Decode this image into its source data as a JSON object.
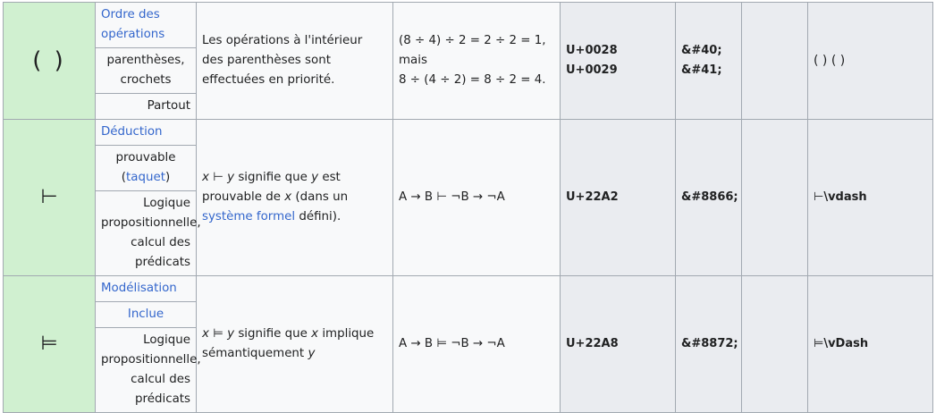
{
  "rows": [
    {
      "symbol": "( )",
      "category": "Ordre des opérations",
      "name": "parenthèses, crochets",
      "domain": "Partout",
      "description": "Les opérations à l'intérieur des parenthèses sont effectuées en priorité.",
      "example_line1": "(8 ÷ 4) ÷ 2 = 2 ÷ 2 = 1, mais",
      "example_line2": "8 ÷ (4 ÷ 2) = 8 ÷ 2 = 4.",
      "unicode": "U+0028 U+0029",
      "entity_1": "&#40;",
      "entity_2": "&#41;",
      "latex": "( ) ( )"
    },
    {
      "symbol": "⊢",
      "category": "Déduction",
      "name_part1": "prouvable",
      "name_link": "taquet",
      "domain": "Logique propositionnelle, calcul des prédicats",
      "desc_x": "x",
      "desc_rel": " ⊢ ",
      "desc_y": "y",
      "desc_text1": " signifie que ",
      "desc_y2": "y",
      "desc_text2": " est prouvable de ",
      "desc_x2": "x",
      "desc_text3": " (dans un ",
      "desc_link": "système formel",
      "desc_text4": " défini).",
      "example": "A → B ⊢ ¬B → ¬A",
      "unicode": "U+22A2",
      "entity": "&#8866;",
      "latex_glyph": "⊢",
      "latex": "\\vdash"
    },
    {
      "symbol": "⊨",
      "category": "Modélisation",
      "name_link": "Inclue",
      "domain": "Logique propositionnelle, calcul des prédicats",
      "desc_x": "x",
      "desc_rel": " ⊨ ",
      "desc_y": "y",
      "desc_text1": " signifie que ",
      "desc_x2": "x",
      "desc_text2": " implique sémantiquement ",
      "desc_y2": "y",
      "example": "A → B ⊨ ¬B → ¬A",
      "unicode": "U+22A8",
      "entity": "&#8872;",
      "latex_glyph": "⊨",
      "latex": "\\vDash"
    }
  ]
}
